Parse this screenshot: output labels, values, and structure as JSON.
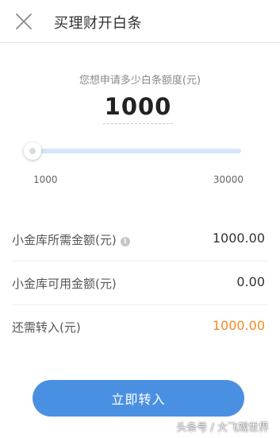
{
  "header": {
    "title": "买理财开白条",
    "close_icon": "close-icon"
  },
  "apply": {
    "prompt": "您想申请多少白条额度(元)",
    "amount": "1000"
  },
  "slider": {
    "value": 1000,
    "min": 1000,
    "max": 30000,
    "min_label": "1000",
    "max_label": "30000",
    "track_color": "#d6e6f8",
    "accent_color": "#4a90e2"
  },
  "rows": [
    {
      "label": "小金库所需金额(元)",
      "value": "1000.00",
      "info_icon": "info-icon"
    },
    {
      "label": "小金库可用金额(元)",
      "value": "0.00"
    },
    {
      "label": "还需转入(元)",
      "value": "1000.00",
      "value_color": "#f08a24"
    }
  ],
  "submit": {
    "label": "立即转入",
    "color": "#4a90e2"
  },
  "watermark": "头条号 / 大飞观世界"
}
